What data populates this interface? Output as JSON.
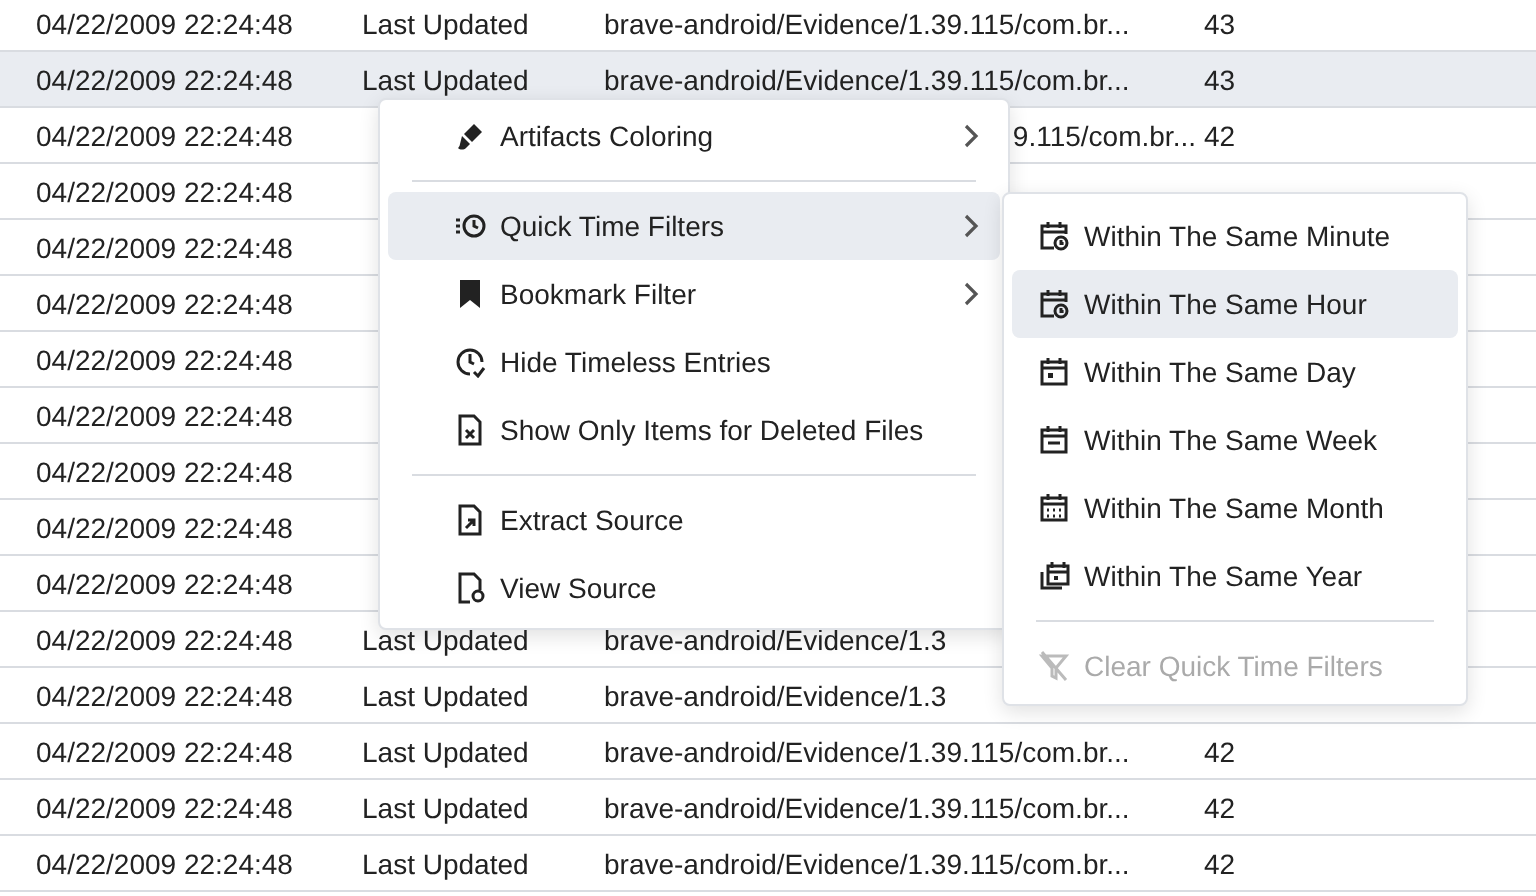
{
  "table": {
    "rows": [
      {
        "date": "04/22/2009 22:24:48",
        "event": "Last Updated",
        "path": "brave-android/Evidence/1.39.115/com.br...",
        "count": "43",
        "selected": false
      },
      {
        "date": "04/22/2009 22:24:48",
        "event": "Last Updated",
        "path": "brave-android/Evidence/1.39.115/com.br...",
        "count": "43",
        "selected": true
      },
      {
        "date": "04/22/2009 22:24:48",
        "path_tail": "9.115/com.br...",
        "count": "42",
        "selected": false
      },
      {
        "date": "04/22/2009 22:24:48",
        "selected": false
      },
      {
        "date": "04/22/2009 22:24:48",
        "selected": false
      },
      {
        "date": "04/22/2009 22:24:48",
        "selected": false
      },
      {
        "date": "04/22/2009 22:24:48",
        "selected": false
      },
      {
        "date": "04/22/2009 22:24:48",
        "selected": false
      },
      {
        "date": "04/22/2009 22:24:48",
        "selected": false
      },
      {
        "date": "04/22/2009 22:24:48",
        "selected": false
      },
      {
        "date": "04/22/2009 22:24:48",
        "selected": false
      },
      {
        "date": "04/22/2009 22:24:48",
        "event": "Last Updated",
        "path": "brave-android/Evidence/1.3",
        "selected": false
      },
      {
        "date": "04/22/2009 22:24:48",
        "event": "Last Updated",
        "path": "brave-android/Evidence/1.3",
        "selected": false
      },
      {
        "date": "04/22/2009 22:24:48",
        "event": "Last Updated",
        "path": "brave-android/Evidence/1.39.115/com.br...",
        "count": "42",
        "selected": false
      },
      {
        "date": "04/22/2009 22:24:48",
        "event": "Last Updated",
        "path": "brave-android/Evidence/1.39.115/com.br...",
        "count": "42",
        "selected": false
      },
      {
        "date": "04/22/2009 22:24:48",
        "event": "Last Updated",
        "path": "brave-android/Evidence/1.39.115/com.br...",
        "count": "42",
        "selected": false
      }
    ]
  },
  "context_menu": {
    "items": [
      {
        "kind": "item",
        "label": "Artifacts Coloring",
        "has_submenu": true,
        "selected": false
      },
      {
        "kind": "divider"
      },
      {
        "kind": "item",
        "label": "Quick Time Filters",
        "has_submenu": true,
        "selected": true
      },
      {
        "kind": "item",
        "label": "Bookmark Filter",
        "has_submenu": true,
        "selected": false
      },
      {
        "kind": "item",
        "label": "Hide Timeless Entries",
        "has_submenu": false,
        "selected": false
      },
      {
        "kind": "item",
        "label": "Show Only Items for Deleted Files",
        "has_submenu": false,
        "selected": false
      },
      {
        "kind": "divider"
      },
      {
        "kind": "item",
        "label": "Extract Source",
        "has_submenu": false,
        "selected": false
      },
      {
        "kind": "item",
        "label": "View Source",
        "has_submenu": false,
        "selected": false
      }
    ]
  },
  "submenu": {
    "items": [
      {
        "kind": "item",
        "label": "Within The Same Minute",
        "selected": false,
        "disabled": false
      },
      {
        "kind": "item",
        "label": "Within The Same Hour",
        "selected": true,
        "disabled": false
      },
      {
        "kind": "item",
        "label": "Within The Same Day",
        "selected": false,
        "disabled": false
      },
      {
        "kind": "item",
        "label": "Within The Same Week",
        "selected": false,
        "disabled": false
      },
      {
        "kind": "item",
        "label": "Within The Same Month",
        "selected": false,
        "disabled": false
      },
      {
        "kind": "item",
        "label": "Within The Same Year",
        "selected": false,
        "disabled": false
      },
      {
        "kind": "divider"
      },
      {
        "kind": "item",
        "label": "Clear Quick Time Filters",
        "selected": false,
        "disabled": true
      }
    ]
  }
}
